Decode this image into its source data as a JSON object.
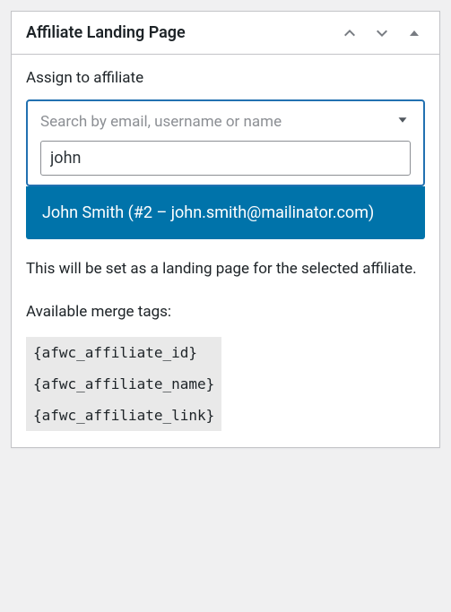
{
  "header": {
    "title": "Affiliate Landing Page"
  },
  "assign": {
    "label": "Assign to affiliate",
    "placeholder": "Search by email, username or name",
    "search_value": "john",
    "result": "John Smith (#2 – john.smith@mailinator.com)"
  },
  "description": {
    "text": "This will be set as a landing page for the selected affiliate.",
    "merge_label": "Available merge tags:",
    "tags": [
      "{afwc_affiliate_id}",
      "{afwc_affiliate_name}",
      "{afwc_affiliate_link}"
    ]
  }
}
